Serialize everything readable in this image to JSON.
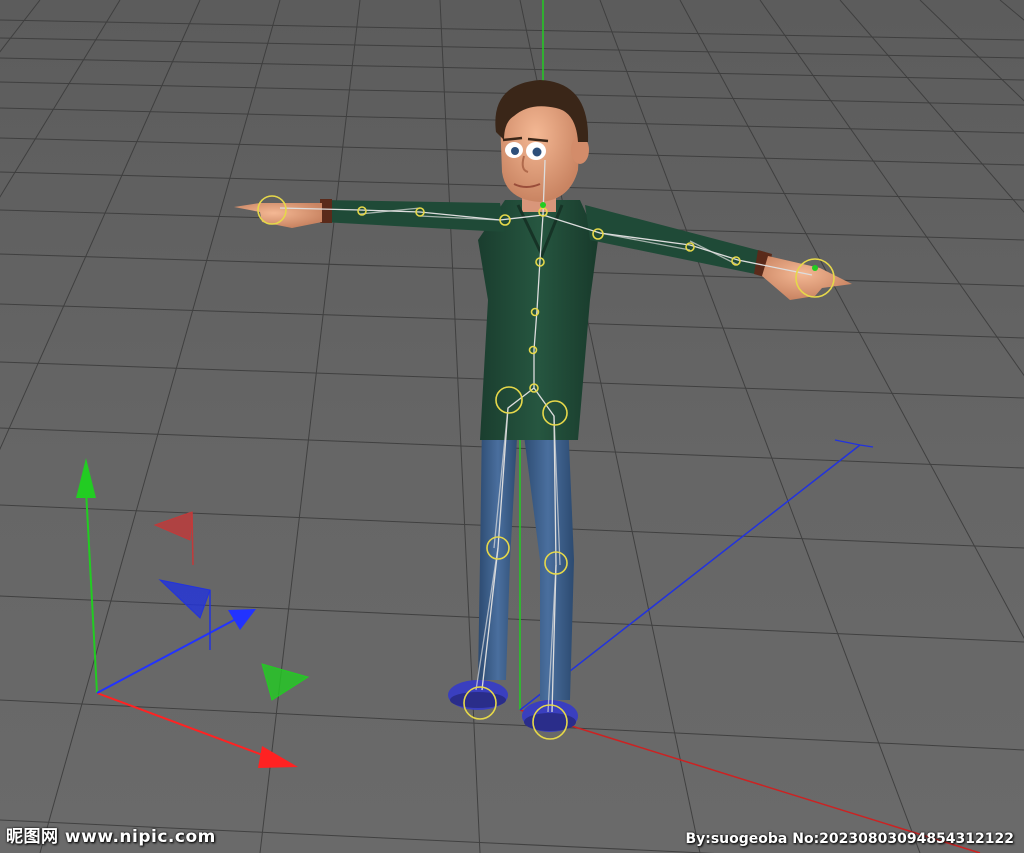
{
  "viewport": {
    "background_color": "#5e5e5e",
    "grid_color": "#3a3a3a",
    "axis_colors": {
      "x": "#ff2222",
      "y": "#22cc22",
      "z": "#2233ff"
    }
  },
  "character": {
    "shirt_color": "#1f4a37",
    "jeans_color": "#3b5f8c",
    "shoe_color": "#3a3fbf",
    "skin_color": "#e8a480",
    "hair_color": "#3a2618",
    "rig_joint_color": "#e6d84a",
    "rig_bone_color": "#dddddd"
  },
  "watermark": {
    "site_name": "昵图网 www.nipic.com",
    "author_info": "By:suogeoba No:20230803094854312122"
  }
}
